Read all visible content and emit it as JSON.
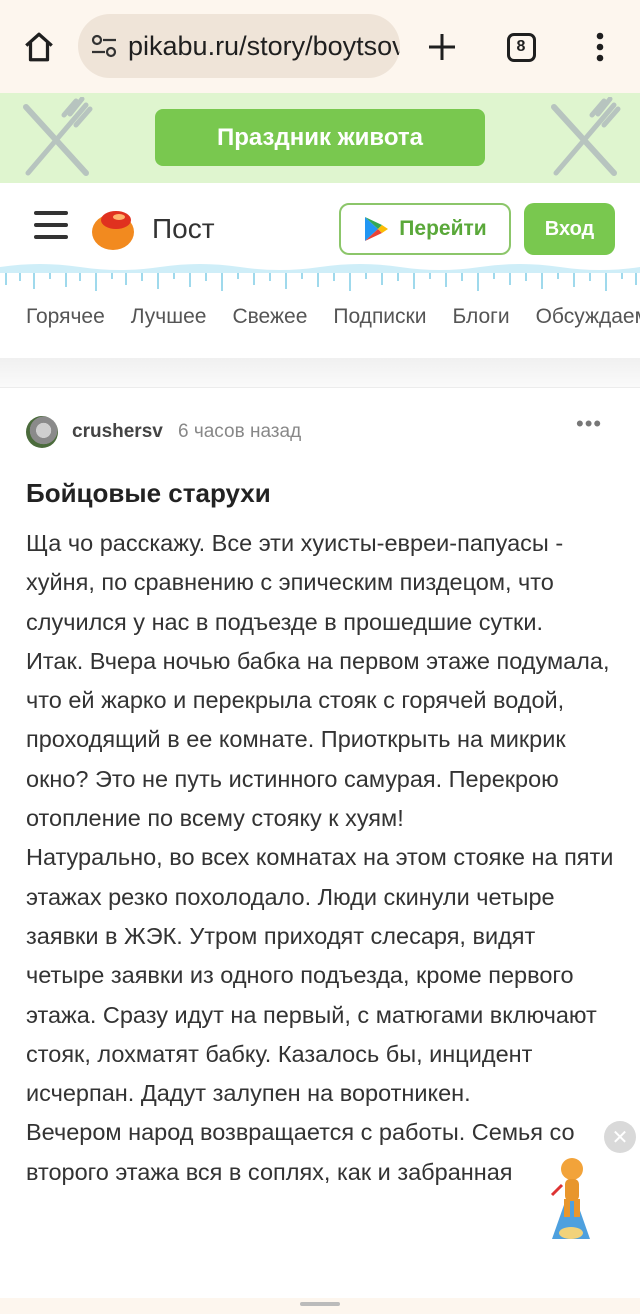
{
  "browser": {
    "url": "pikabu.ru/story/boytsovyie_staruhi",
    "tab_count": "8"
  },
  "promo": {
    "button_label": "Праздник живота"
  },
  "header": {
    "title": "Пост",
    "goto_label": "Перейти",
    "login_label": "Вход",
    "nav": [
      "Горячее",
      "Лучшее",
      "Свежее",
      "Подписки",
      "Блоги",
      "Обсуждаемое"
    ]
  },
  "post": {
    "author": "crushersv",
    "time": "6 часов назад",
    "more": "•••",
    "title": "Бойцовые старухи",
    "paragraphs": [
      "Ща чо расскажу. Все эти хуисты-евреи-папуасы - хуйня, по сравнению с эпическим пиздецом, что случился у нас в подъезде в прошедшие сутки.",
      "Итак. Вчера ночью бабка на первом этаже подумала, что ей жарко и перекрыла стояк с горячей водой, проходящий в ее комнате. Приоткрыть на микрик окно? Это не путь истинного самурая. Перекрою отопление по всему стояку к хуям!",
      "Натурально, во всех комнатах на этом стояке на пяти этажах резко похолодало. Люди скинули четыре заявки в ЖЭК. Утром приходят слесаря, видят четыре заявки из одного подъезда, кроме первого этажа. Сразу идут на первый, с матюгами включают стояк, лохматят бабку. Казалось бы, инцидент исчерпан. Дадут залупен на воротникен.",
      "Вечером народ возвращается с работы. Семья со второго этажа вся в соплях, как и забранная"
    ]
  },
  "floating": {
    "close_glyph": "✕"
  },
  "colors": {
    "brand_green": "#79c84f",
    "promo_bg": "#dff5cf",
    "browser_bg": "#fdf6ee"
  }
}
